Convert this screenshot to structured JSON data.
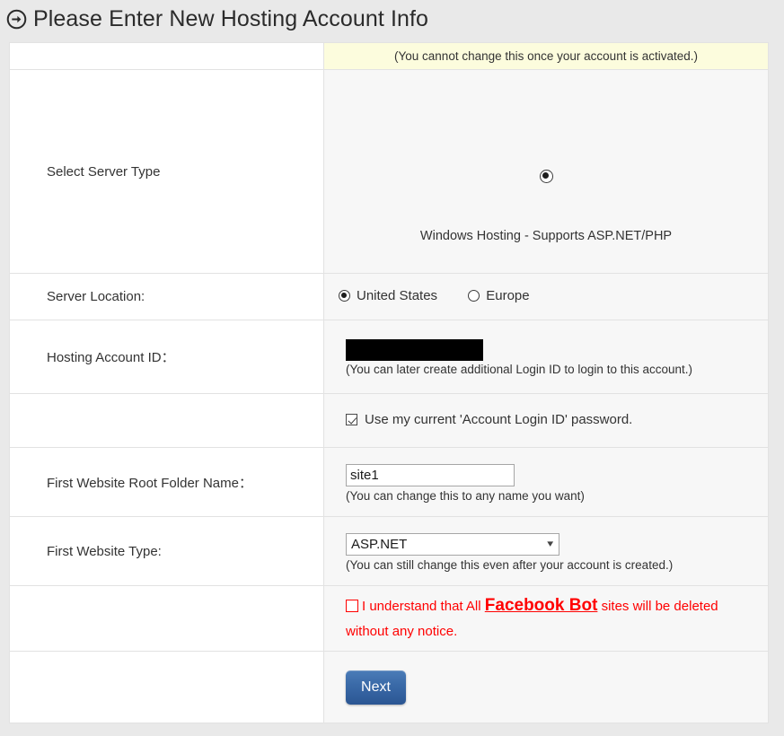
{
  "page": {
    "title": "Please Enter New Hosting Account Info",
    "title_icon": "arrow-circle-right-icon"
  },
  "notice": {
    "text": "(You cannot change this once your account is activated.)"
  },
  "rows": {
    "server_type": {
      "label": "Select Server Type",
      "option_label": "Windows Hosting - Supports ASP.NET/PHP",
      "selected": true
    },
    "server_location": {
      "label": "Server Location:",
      "options": [
        {
          "label": "United States",
          "selected": true
        },
        {
          "label": "Europe",
          "selected": false
        }
      ]
    },
    "hosting_account_id": {
      "label": "Hosting Account ID：",
      "value": "",
      "redacted": true,
      "hint": "(You can later create additional Login ID to login to this account.)"
    },
    "use_current_password": {
      "label": "",
      "checkbox_label": "Use my current 'Account Login ID' password.",
      "checked": true
    },
    "root_folder": {
      "label": "First Website Root Folder Name：",
      "value": "site1",
      "hint": "(You can change this to any name you want)"
    },
    "website_type": {
      "label": "First Website Type:",
      "selected": "ASP.NET",
      "options": [
        "ASP.NET"
      ],
      "hint": "(You can still change this even after your account is created.)",
      "chevron_icon": "chevron-down-icon"
    },
    "facebook_bot_warning": {
      "text_before": "I understand that All",
      "link_text": "Facebook Bot",
      "text_after": "sites will be deleted without any notice.",
      "checked": false,
      "color": "#ff0000"
    },
    "submit": {
      "label": "Next"
    }
  },
  "colors": {
    "page_background": "#e9e9e9",
    "notice_background": "#fcfcdd",
    "field_background": "#f7f7f7",
    "label_background": "#ffffff",
    "border": "#e2e2e2",
    "warning_red": "#ff0000",
    "button_blue": "#3a6aa8",
    "redaction": "#000000"
  }
}
